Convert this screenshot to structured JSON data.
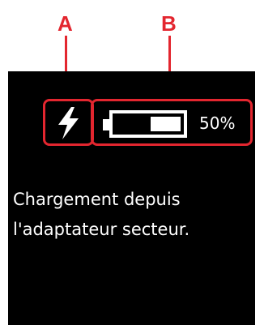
{
  "callouts": {
    "a": "A",
    "b": "B"
  },
  "status": {
    "charging_icon": "lightning-bolt-icon",
    "battery_icon": "battery-icon",
    "battery_level": 0.5,
    "battery_percent": "50%"
  },
  "message": {
    "line1": "Chargement depuis",
    "line2": "l'adaptateur secteur."
  },
  "colors": {
    "callout": "#e3262f",
    "screen": "#000000",
    "text": "#ffffff"
  }
}
